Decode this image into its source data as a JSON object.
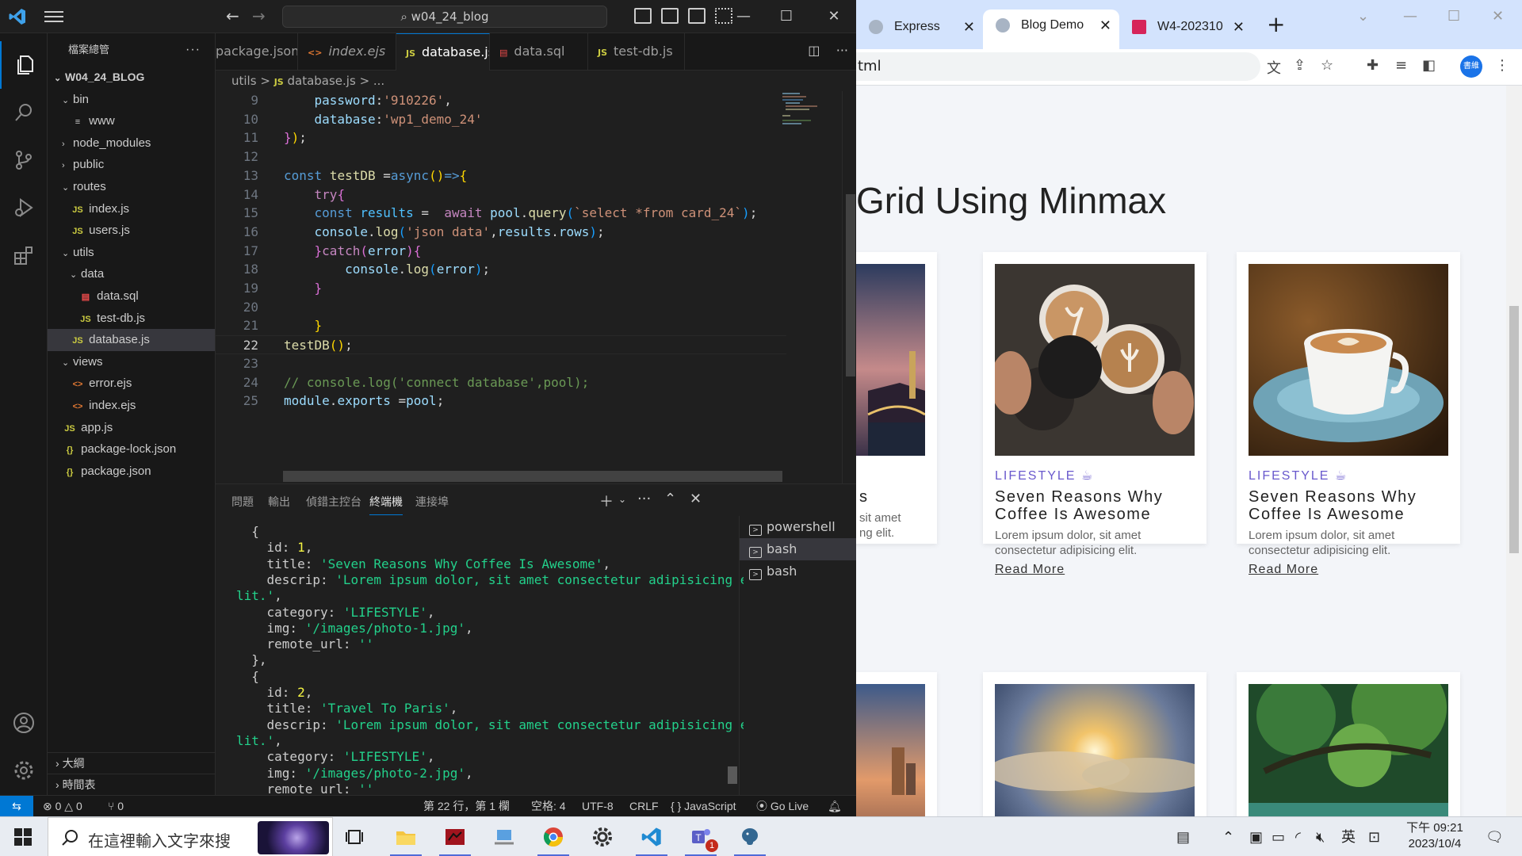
{
  "vscode": {
    "search_label": "w04_24_blog",
    "window_min": "—",
    "window_max": "☐",
    "window_close": "✕",
    "explorer_title": "檔案總管",
    "tree": [
      {
        "label": "W04_24_BLOG",
        "kind": "root",
        "depth": 0,
        "chev": "⌄"
      },
      {
        "label": "bin",
        "kind": "folder",
        "depth": 1,
        "chev": "⌄"
      },
      {
        "label": "www",
        "kind": "file",
        "icon": "≡",
        "icls": "txt-ico",
        "depth": 2
      },
      {
        "label": "node_modules",
        "kind": "folder",
        "depth": 1,
        "chev": "›"
      },
      {
        "label": "public",
        "kind": "folder",
        "depth": 1,
        "chev": "›"
      },
      {
        "label": "routes",
        "kind": "folder",
        "depth": 1,
        "chev": "⌄"
      },
      {
        "label": "index.js",
        "kind": "file",
        "icon": "JS",
        "icls": "js-ico",
        "depth": 2
      },
      {
        "label": "users.js",
        "kind": "file",
        "icon": "JS",
        "icls": "js-ico",
        "depth": 2
      },
      {
        "label": "utils",
        "kind": "folder",
        "depth": 1,
        "chev": "⌄"
      },
      {
        "label": "data",
        "kind": "folder",
        "depth": 2,
        "chev": "⌄"
      },
      {
        "label": "data.sql",
        "kind": "file",
        "icon": "▤",
        "icls": "sql-ico",
        "depth": 3
      },
      {
        "label": "test-db.js",
        "kind": "file",
        "icon": "JS",
        "icls": "js-ico",
        "depth": 3
      },
      {
        "label": "database.js",
        "kind": "file",
        "icon": "JS",
        "icls": "js-ico",
        "depth": 2,
        "selected": true
      },
      {
        "label": "views",
        "kind": "folder",
        "depth": 1,
        "chev": "⌄"
      },
      {
        "label": "error.ejs",
        "kind": "file",
        "icon": "<>",
        "icls": "ejs-ico",
        "depth": 2
      },
      {
        "label": "index.ejs",
        "kind": "file",
        "icon": "<>",
        "icls": "ejs-ico",
        "depth": 2
      },
      {
        "label": "app.js",
        "kind": "file",
        "icon": "JS",
        "icls": "js-ico",
        "depth": 1
      },
      {
        "label": "package-lock.json",
        "kind": "file",
        "icon": "{}",
        "icls": "json-ico",
        "depth": 1
      },
      {
        "label": "package.json",
        "kind": "file",
        "icon": "{}",
        "icls": "json-ico",
        "depth": 1
      }
    ],
    "outline_label": "大綱",
    "timeline_label": "時間表",
    "tabs": [
      {
        "label": "package.json",
        "icon": "",
        "icls": "json-ico"
      },
      {
        "label": "index.ejs",
        "icon": "<>",
        "icls": "ejs-ico",
        "italic": true
      },
      {
        "label": "database.js",
        "icon": "JS",
        "icls": "js-ico",
        "active": true
      },
      {
        "label": "data.sql",
        "icon": "▤",
        "icls": "sql-ico"
      },
      {
        "label": "test-db.js",
        "icon": "JS",
        "icls": "js-ico"
      }
    ],
    "breadcrumb": {
      "folder": "utils",
      "sep": ">",
      "file": "database.js",
      "tail": "> ..."
    },
    "code_lines": [
      {
        "n": "9",
        "html": "    <span class=\"v\">password</span><span class=\"p\">:</span><span class=\"s\">'910226'</span><span class=\"p\">,</span>"
      },
      {
        "n": "10",
        "html": "    <span class=\"v\">database</span><span class=\"p\">:</span><span class=\"s\">'wp1_demo_24'</span>"
      },
      {
        "n": "11",
        "html": "<span class=\"pp\">}</span><span class=\"y\">)</span><span class=\"p\">;</span>"
      },
      {
        "n": "12",
        "html": ""
      },
      {
        "n": "13",
        "html": "<span class=\"k\">const</span> <span class=\"f\">testDB</span> <span class=\"p\">=</span><span class=\"k\">async</span><span class=\"y\">()</span><span class=\"k\">=></span><span class=\"y\">{</span>"
      },
      {
        "n": "14",
        "html": "    <span class=\"kc\">try</span><span class=\"pp\">{</span>"
      },
      {
        "n": "15",
        "html": "    <span class=\"k\">const</span> <span class=\"cn\">results</span> <span class=\"p\">=</span>  <span class=\"kc\">await</span> <span class=\"v\">pool</span><span class=\"p\">.</span><span class=\"f\">query</span><span class=\"bl\">(</span><span class=\"s\">`select *from card_24`</span><span class=\"bl\">)</span><span class=\"p\">;</span>"
      },
      {
        "n": "16",
        "html": "    <span class=\"v\">console</span><span class=\"p\">.</span><span class=\"f\">log</span><span class=\"bl\">(</span><span class=\"s\">'json data'</span><span class=\"p\">,</span><span class=\"v\">results</span><span class=\"p\">.</span><span class=\"v\">rows</span><span class=\"bl\">)</span><span class=\"p\">;</span>"
      },
      {
        "n": "17",
        "html": "    <span class=\"pp\">}</span><span class=\"kc\">catch</span><span class=\"pp\">(</span><span class=\"v\">error</span><span class=\"pp\">){</span>"
      },
      {
        "n": "18",
        "html": "        <span class=\"v\">console</span><span class=\"p\">.</span><span class=\"f\">log</span><span class=\"bl\">(</span><span class=\"v\">error</span><span class=\"bl\">)</span><span class=\"p\">;</span>"
      },
      {
        "n": "19",
        "html": "    <span class=\"pp\">}</span>"
      },
      {
        "n": "20",
        "html": ""
      },
      {
        "n": "21",
        "html": "    <span class=\"y\">}</span>"
      },
      {
        "n": "22",
        "html": "<span class=\"f\">testDB</span><span class=\"y\">()</span><span class=\"p\">;</span>",
        "current": true
      },
      {
        "n": "23",
        "html": ""
      },
      {
        "n": "24",
        "html": "<span class=\"c\">// console.log('connect database',pool);</span>"
      },
      {
        "n": "25",
        "html": "<span class=\"v\">module</span><span class=\"p\">.</span><span class=\"v\">exports</span> <span class=\"p\">=</span><span class=\"v\">pool</span><span class=\"p\">;</span>"
      }
    ],
    "panel_tabs": [
      "問題",
      "輸出",
      "偵錯主控台",
      "終端機",
      "連接埠"
    ],
    "panel_active_tab": 3,
    "terminal_lines": [
      {
        "html": "  {"
      },
      {
        "html": "    id: <span class=\"tn\">1</span>,"
      },
      {
        "html": "    title: <span class=\"ts\">'Seven Reasons Why Coffee Is Awesome'</span>,"
      },
      {
        "html": "    descrip: <span class=\"ts\">'Lorem ipsum dolor, sit amet consectetur adipisicing e</span>"
      },
      {
        "html": "<span class=\"ts\">lit.'</span>,"
      },
      {
        "html": "    category: <span class=\"ts\">'LIFESTYLE'</span>,"
      },
      {
        "html": "    img: <span class=\"ts\">'/images/photo-1.jpg'</span>,"
      },
      {
        "html": "    remote_url: <span class=\"ts\">''</span>"
      },
      {
        "html": "  },"
      },
      {
        "html": "  {"
      },
      {
        "html": "    id: <span class=\"tn\">2</span>,"
      },
      {
        "html": "    title: <span class=\"ts\">'Travel To Paris'</span>,"
      },
      {
        "html": "    descrip: <span class=\"ts\">'Lorem ipsum dolor, sit amet consectetur adipisicing e</span>"
      },
      {
        "html": "<span class=\"ts\">lit.'</span>,"
      },
      {
        "html": "    category: <span class=\"ts\">'LIFESTYLE'</span>,"
      },
      {
        "html": "    img: <span class=\"ts\">'/images/photo-2.jpg'</span>,"
      },
      {
        "html": "    remote_url: <span class=\"ts\">''</span>"
      }
    ],
    "terminals": [
      {
        "label": "powershell",
        "active": false
      },
      {
        "label": "bash",
        "active": true
      },
      {
        "label": "bash",
        "active": false
      }
    ],
    "status": {
      "errors": "⊗ 0 △ 0",
      "ports": "⑂ 0",
      "position": "第 22 行，第 1 欄",
      "spaces": "空格: 4",
      "encoding": "UTF-8",
      "eol": "CRLF",
      "language": "{ } JavaScript",
      "golive": "Go Live"
    }
  },
  "chrome": {
    "tabs": [
      {
        "label": "Express",
        "active": false
      },
      {
        "label": "Blog Demo",
        "active": true
      },
      {
        "label": "W4-202310",
        "active": false
      }
    ],
    "url": "tml",
    "profile": "書維",
    "page_title": "Grid Using Minmax",
    "cards": [
      {
        "category": "LIFESTYLE",
        "title": "Seven Reasons Why Coffee Is Awesome",
        "desc": "Lorem ipsum dolor, sit amet consectetur adipisicing elit.",
        "link": "Read More"
      },
      {
        "category": "LIFESTYLE",
        "title": "Seven Reasons Why Coffee Is Awesome",
        "desc": "Lorem ipsum dolor, sit amet consectetur adipisicing elit.",
        "link": "Read More"
      }
    ],
    "partial_card": {
      "title_tail": "s",
      "desc_tail1": "sit amet",
      "desc_tail2": "ng elit."
    }
  },
  "taskbar": {
    "search_placeholder": "在這裡輸入文字來搜",
    "ime": "英",
    "time": "下午 09:21",
    "date": "2023/10/4",
    "teams_badge": "1"
  },
  "colors": {
    "accent": "#0078d4",
    "purple": "#6a5acd"
  }
}
